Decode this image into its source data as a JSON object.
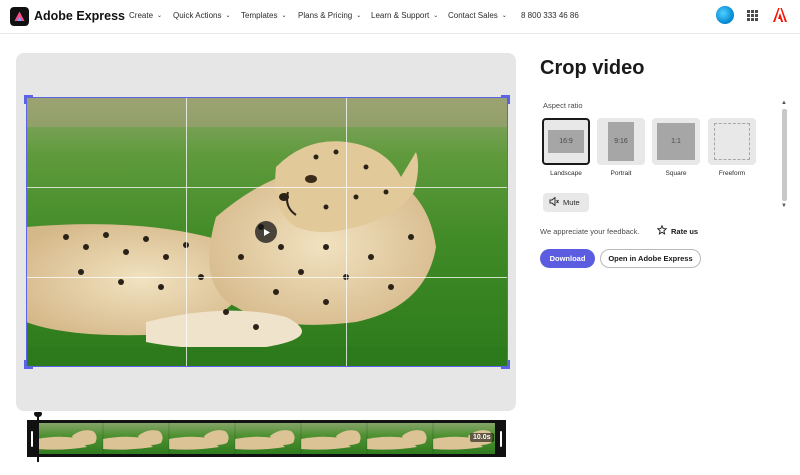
{
  "header": {
    "brand": "Adobe Express",
    "nav": [
      {
        "label": "Create",
        "has_chevron": true
      },
      {
        "label": "Quick Actions",
        "has_chevron": true
      },
      {
        "label": "Templates",
        "has_chevron": true
      },
      {
        "label": "Plans & Pricing",
        "has_chevron": true
      },
      {
        "label": "Learn & Support",
        "has_chevron": true
      },
      {
        "label": "Contact Sales",
        "has_chevron": true
      }
    ],
    "phone": "8 800 333 46 86",
    "icons": [
      "adobe-express-logo-icon",
      "avatar",
      "apps-grid-icon",
      "adobe-logo-icon"
    ]
  },
  "editor": {
    "play_icon": "play-icon",
    "timeline": {
      "duration": "10.0s"
    }
  },
  "panel": {
    "title": "Crop video",
    "aspect_ratio_label": "Aspect ratio",
    "options": [
      {
        "ratio": "16:9",
        "label": "Landscape",
        "selected": true
      },
      {
        "ratio": "9:16",
        "label": "Portrait",
        "selected": false
      },
      {
        "ratio": "1:1",
        "label": "Square",
        "selected": false
      },
      {
        "ratio": "",
        "label": "Freeform",
        "selected": false
      }
    ],
    "mute_label": "Mute",
    "feedback_text": "We appreciate your feedback.",
    "rate_label": "Rate us",
    "download_label": "Download",
    "open_label": "Open in Adobe Express"
  },
  "colors": {
    "accent": "#5c5ce0",
    "crop_frame": "#5a64e6",
    "stage_bg": "#e6e6e6"
  }
}
